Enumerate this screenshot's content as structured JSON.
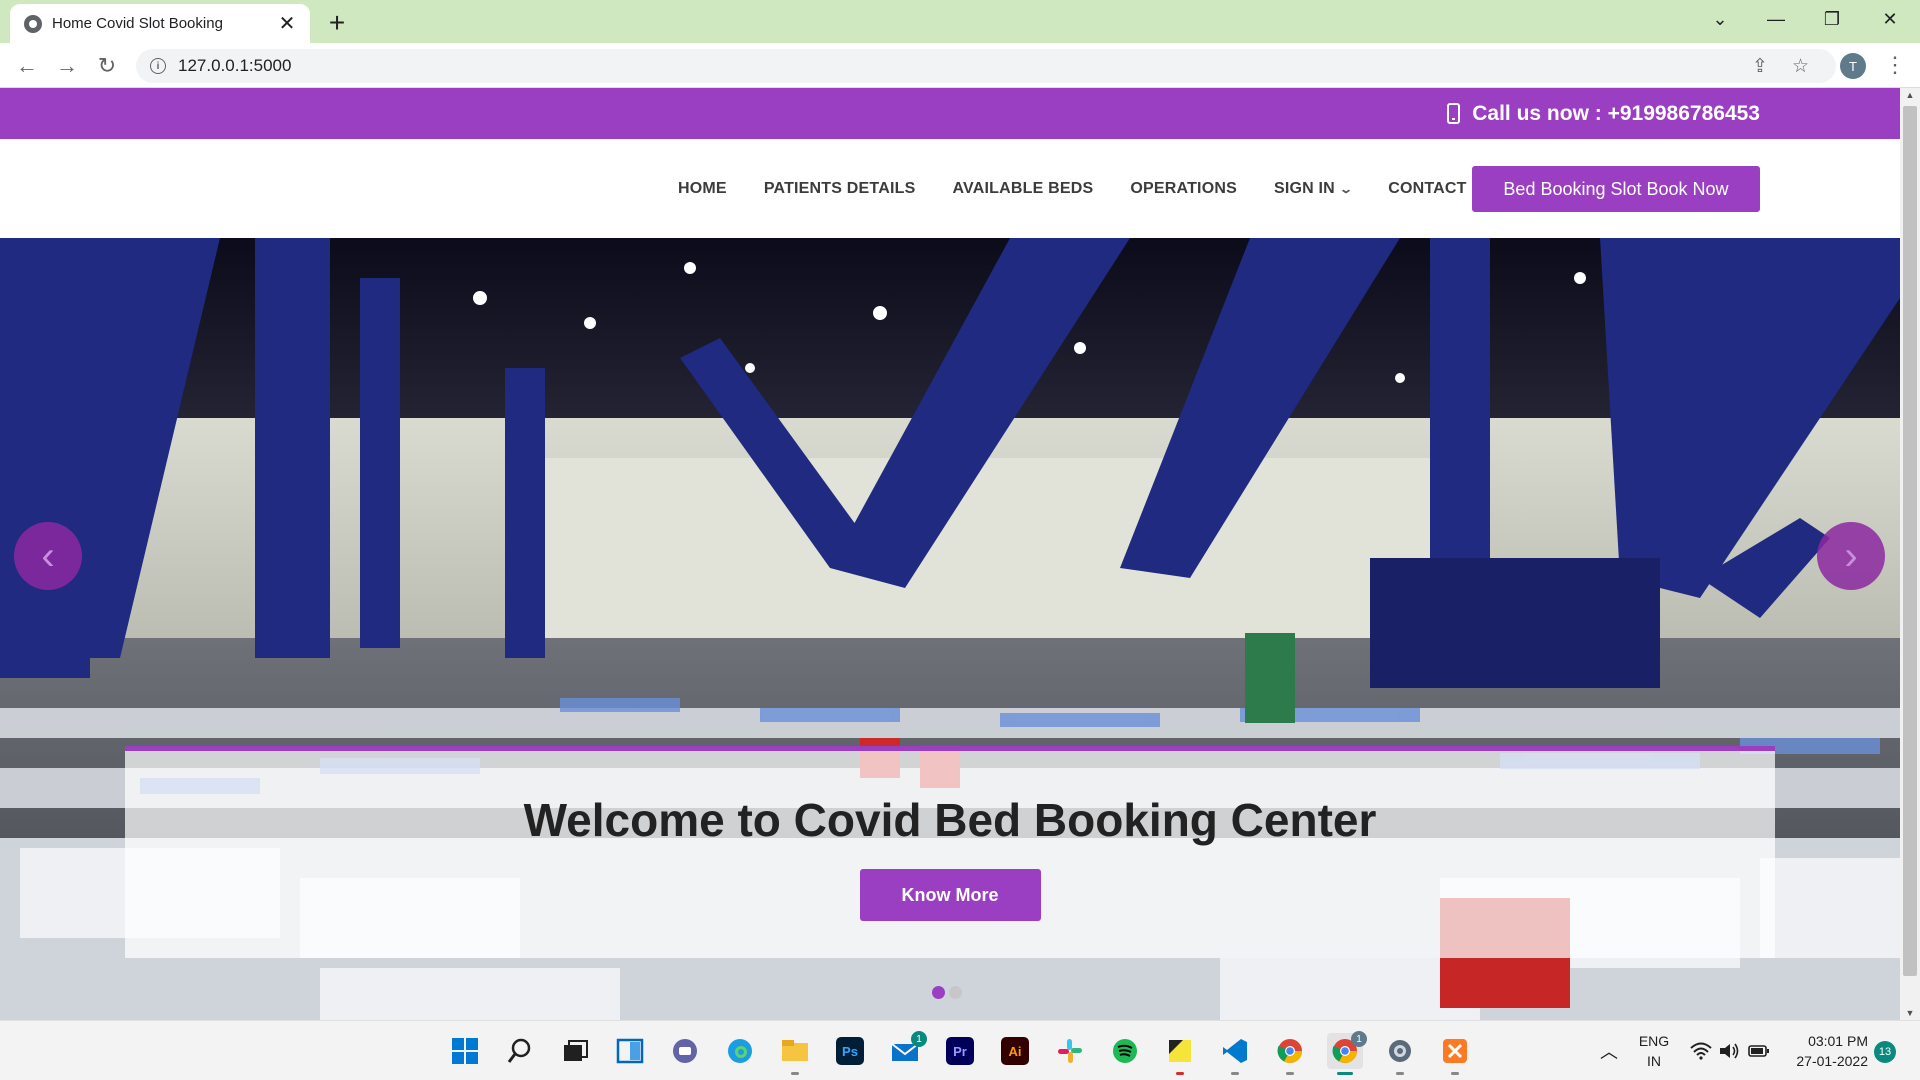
{
  "browser": {
    "tab_title": "Home Covid Slot Booking",
    "url": "127.0.0.1:5000",
    "profile_initial": "T"
  },
  "site": {
    "topbar": {
      "call_text": "Call us now : +919986786453"
    },
    "nav": {
      "items": [
        {
          "label": "HOME"
        },
        {
          "label": "PATIENTS DETAILS"
        },
        {
          "label": "AVAILABLE BEDS"
        },
        {
          "label": "OPERATIONS"
        },
        {
          "label": "SIGN IN",
          "dropdown": true
        },
        {
          "label": "CONTACT"
        }
      ],
      "cta_label": "Bed Booking Slot Book Now"
    },
    "hero": {
      "heading": "Welcome to Covid Bed Booking Center",
      "button_label": "Know More",
      "slide_count": 2,
      "active_slide": 1
    }
  },
  "taskbar": {
    "icons": [
      "windows-start-icon",
      "search-icon",
      "task-view-icon",
      "widgets-icon",
      "teams-chat-icon",
      "edge-icon",
      "file-explorer-icon",
      "photoshop-icon",
      "mail-icon",
      "premiere-icon",
      "illustrator-icon",
      "slack-icon",
      "spotify-icon",
      "sticky-notes-icon",
      "vscode-icon",
      "chrome-icon",
      "chrome-profile-icon",
      "settings-icon",
      "xampp-icon"
    ],
    "app_labels": {
      "photoshop": "Ps",
      "premiere": "Pr",
      "illustrator": "Ai"
    },
    "mail_badge": "1",
    "chrome_badge": "1",
    "lang_line1": "ENG",
    "lang_line2": "IN",
    "time": "03:01 PM",
    "date": "27-01-2022",
    "notification_count": "13"
  },
  "colors": {
    "brand_purple": "#9b3fc2",
    "tab_strip": "#cfe8c0"
  }
}
